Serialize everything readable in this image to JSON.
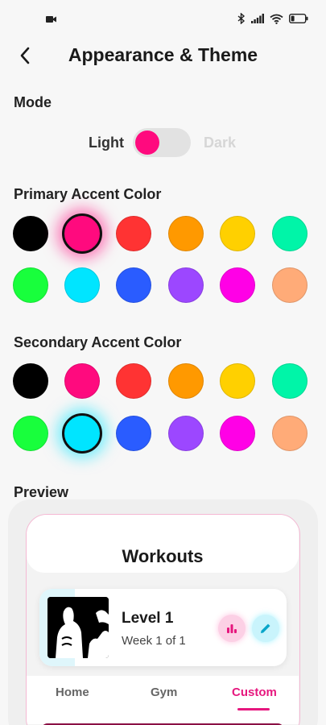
{
  "header": {
    "title": "Appearance & Theme"
  },
  "mode": {
    "section_title": "Mode",
    "light_label": "Light",
    "dark_label": "Dark",
    "selected": "Light"
  },
  "primary": {
    "section_title": "Primary Accent Color",
    "selected_index": 1,
    "colors": [
      "#000000",
      "#ff0a7e",
      "#ff3333",
      "#ff9900",
      "#ffd000",
      "#00f5a8",
      "#18ff3c",
      "#00e5ff",
      "#2a5cff",
      "#9c47ff",
      "#ff00e6",
      "#ffab78"
    ]
  },
  "secondary": {
    "section_title": "Secondary Accent Color",
    "selected_index": 7,
    "colors": [
      "#000000",
      "#ff0a7e",
      "#ff3333",
      "#ff9900",
      "#ffd000",
      "#00f5a8",
      "#18ff3c",
      "#00e5ff",
      "#2a5cff",
      "#9c47ff",
      "#ff00e6",
      "#ffab78"
    ]
  },
  "preview": {
    "section_title": "Preview",
    "screen_title": "Workouts",
    "workout": {
      "title": "Level 1",
      "subtitle": "Week 1 of 1"
    },
    "tabs": [
      "Home",
      "Gym",
      "Custom"
    ],
    "active_tab": "Custom"
  },
  "icons": {
    "status": [
      "video-camera-icon",
      "bluetooth-icon",
      "signal-icon",
      "wifi-icon",
      "battery-icon"
    ],
    "back": "arrow-left-icon",
    "stats": "bar-chart-icon",
    "edit": "pencil-icon"
  },
  "accent_colors": {
    "primary": "#ff0a7e",
    "secondary": "#00e5ff"
  }
}
